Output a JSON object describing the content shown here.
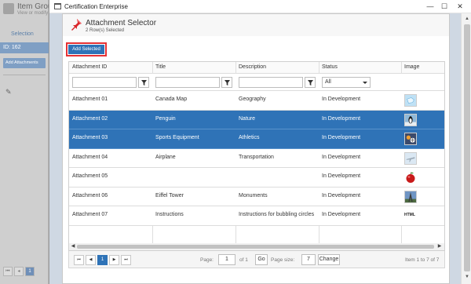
{
  "background": {
    "title": "Item Grou",
    "subtitle": "View or modify",
    "selection_label": "Selection",
    "id_label": "ID: 162",
    "add_attachments_label": "Add Attachments",
    "pager_page": "1"
  },
  "window": {
    "title": "Certification Enterprise",
    "minimize": "—",
    "maximize": "☐",
    "close": "✕"
  },
  "dialog": {
    "title": "Attachment Selector",
    "subtitle": "2 Row(s) Selected",
    "add_selected_label": "Add Selected"
  },
  "grid": {
    "columns": [
      "Attachment ID",
      "Title",
      "Description",
      "Status",
      "Image"
    ],
    "status_filter_value": "All",
    "rows": [
      {
        "id": "Attachment 01",
        "title": "Canada Map",
        "description": "Geography",
        "status": "In Development",
        "image": "map-thumbnail",
        "selected": false
      },
      {
        "id": "Attachment 02",
        "title": "Penguin",
        "description": "Nature",
        "status": "In Development",
        "image": "penguin-thumbnail",
        "selected": true
      },
      {
        "id": "Attachment 03",
        "title": "Sports Equipment",
        "description": "Athletics",
        "status": "In Development",
        "image": "sports-thumbnail",
        "selected": true
      },
      {
        "id": "Attachment 04",
        "title": "Airplane",
        "description": "Transportation",
        "status": "In Development",
        "image": "airplane-thumbnail",
        "selected": false
      },
      {
        "id": "Attachment 05",
        "title": "",
        "description": "",
        "status": "In Development",
        "image": "apple-thumbnail",
        "selected": false
      },
      {
        "id": "Attachment 06",
        "title": "Eiffel Tower",
        "description": "Monuments",
        "status": "In Development",
        "image": "eiffel-thumbnail",
        "selected": false
      },
      {
        "id": "Attachment 07",
        "title": "Instructions",
        "description": "Instructions for bubbling circles",
        "status": "In Development",
        "image": "HTML",
        "selected": false
      }
    ]
  },
  "pager": {
    "current_page": "1",
    "page_label": "Page:",
    "page_input": "1",
    "of_label": "of 1",
    "go_label": "Go",
    "page_size_label": "Page size:",
    "page_size_value": "7",
    "change_label": "Change",
    "info": "Item 1 to 7 of 7"
  },
  "colors": {
    "accent": "#2f73b7",
    "highlight_border": "#e53235"
  }
}
